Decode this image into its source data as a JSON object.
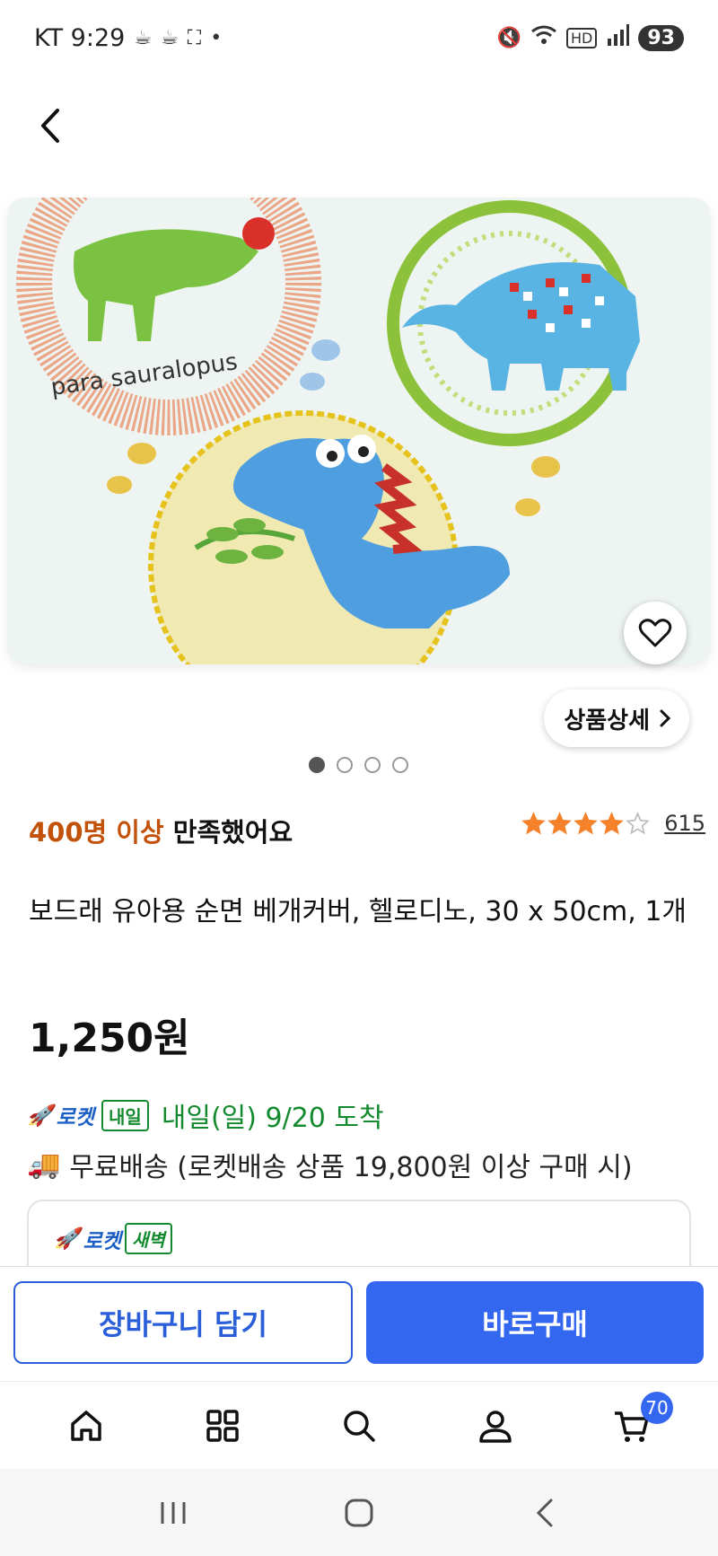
{
  "status_bar": {
    "carrier_time": "KT 9:29",
    "battery": "93"
  },
  "product": {
    "detail_button_label": "상품상세",
    "image_count": 4,
    "active_image_index": 0,
    "satisfaction_highlight": "400명 이상",
    "satisfaction_rest": " 만족했어요",
    "rating": 4,
    "rating_max": 5,
    "rating_count": "615",
    "title": "보드래 유아용 순면 베개커버, 헬로디노, 30 x 50cm, 1개",
    "price": "1,250원"
  },
  "delivery": {
    "rocket_label": "로켓",
    "rocket_badge": "내일",
    "arrival_text": "내일(일) 9/20 도착",
    "free_shipping_text": "무료배송 (로켓배송 상품 19,800원 이상 구매 시)",
    "dawn_rocket_label": "로켓",
    "dawn_badge": "새벽"
  },
  "actions": {
    "cart_label": "장바구니 담기",
    "buy_label": "바로구매"
  },
  "bottom_nav": {
    "items": [
      {
        "icon": "home-icon"
      },
      {
        "icon": "category-grid-icon"
      },
      {
        "icon": "search-icon"
      },
      {
        "icon": "user-icon"
      },
      {
        "icon": "cart-icon"
      }
    ],
    "cart_count": "70"
  },
  "colors": {
    "accent_blue": "#3467ef",
    "highlight_orange": "#c2520a",
    "delivery_green": "#148a2e",
    "star_orange": "#f5822a"
  }
}
